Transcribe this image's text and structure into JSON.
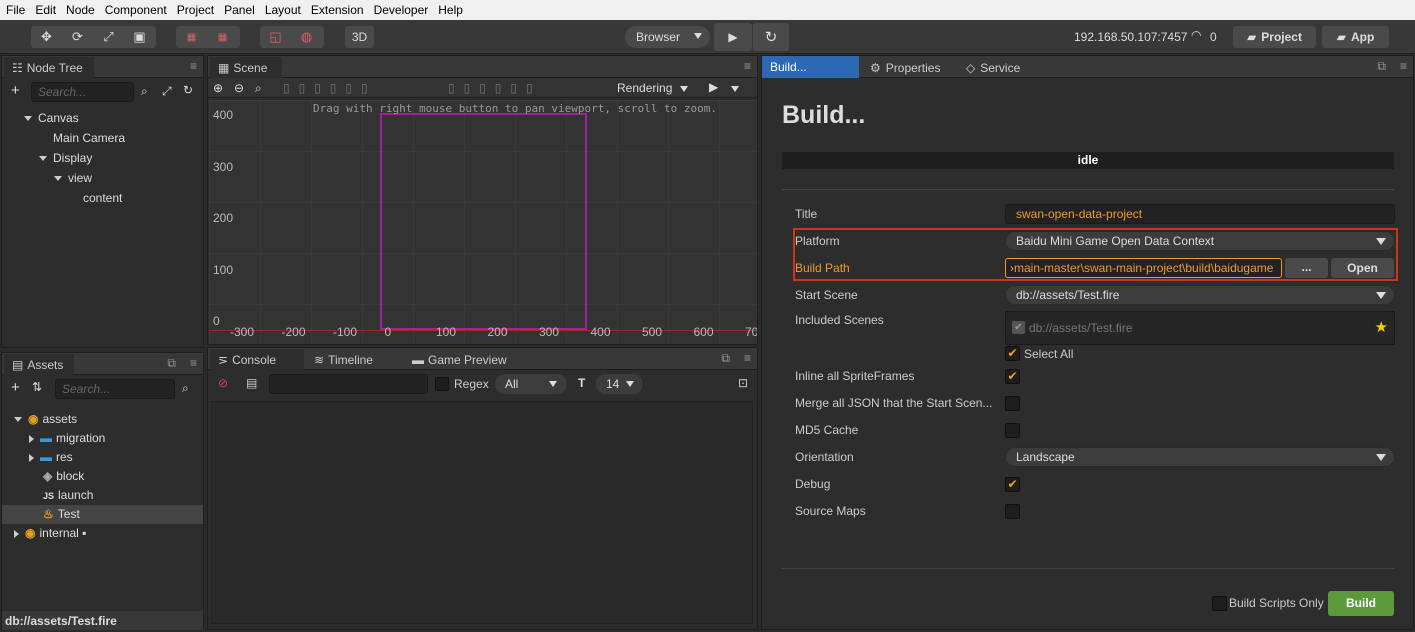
{
  "menu": [
    "File",
    "Edit",
    "Node",
    "Component",
    "Project",
    "Panel",
    "Layout",
    "Extension",
    "Developer",
    "Help"
  ],
  "toolbar": {
    "mode3d": "3D",
    "browser": "Browser",
    "ip": "192.168.50.107:7457",
    "conn": "0",
    "project": "Project",
    "app": "App"
  },
  "nodetree": {
    "tab": "Node Tree",
    "search": "Search...",
    "items": [
      {
        "label": "Canvas",
        "depth": 0,
        "arrow": "down"
      },
      {
        "label": "Main Camera",
        "depth": 1,
        "arrow": "none"
      },
      {
        "label": "Display",
        "depth": 1,
        "arrow": "down"
      },
      {
        "label": "view",
        "depth": 2,
        "arrow": "down"
      },
      {
        "label": "content",
        "depth": 3,
        "arrow": "none"
      }
    ]
  },
  "assets": {
    "tab": "Assets",
    "search": "Search...",
    "items": [
      {
        "label": "assets",
        "icon": "db",
        "depth": 0,
        "arrow": "down"
      },
      {
        "label": "migration",
        "icon": "folder",
        "depth": 1,
        "arrow": "right"
      },
      {
        "label": "res",
        "icon": "folder",
        "depth": 1,
        "arrow": "right"
      },
      {
        "label": "block",
        "icon": "prefab",
        "depth": 1,
        "arrow": "none"
      },
      {
        "label": "launch",
        "icon": "js",
        "depth": 1,
        "arrow": "none"
      },
      {
        "label": "Test",
        "icon": "scene",
        "depth": 1,
        "arrow": "none",
        "selected": true
      },
      {
        "label": "internal",
        "icon": "db",
        "depth": 0,
        "arrow": "right",
        "locked": true
      }
    ],
    "footer": "db://assets/Test.fire"
  },
  "scene": {
    "tab": "Scene",
    "rendering": "Rendering",
    "hint": "Drag with right mouse button to pan viewport, scroll to zoom.",
    "yticks": [
      "400",
      "300",
      "200",
      "100",
      "0"
    ],
    "xticks": [
      "-300",
      "-200",
      "-100",
      "0",
      "100",
      "200",
      "300",
      "400",
      "500",
      "600",
      "70"
    ]
  },
  "console": {
    "tabs": [
      "Console",
      "Timeline",
      "Game Preview"
    ],
    "regex": "Regex",
    "level": "All",
    "fontsize": "14"
  },
  "build": {
    "tabs": [
      "Build...",
      "Properties",
      "Service"
    ],
    "heading": "Build...",
    "status": "idle",
    "title_label": "Title",
    "title_value": "swan-open-data-project",
    "platform_label": "Platform",
    "platform_value": "Baidu Mini Game Open Data Context",
    "buildpath_label": "Build Path",
    "buildpath_value": "›main-master\\swan-main-project\\build\\baidugame",
    "browse": "...",
    "open": "Open",
    "startscene_label": "Start Scene",
    "startscene_value": "db://assets/Test.fire",
    "included_label": "Included Scenes",
    "included_value": "db://assets/Test.fire",
    "selectall": "Select All",
    "inline_label": "Inline all SpriteFrames",
    "merge_label": "Merge all JSON that the Start Scen...",
    "md5_label": "MD5 Cache",
    "orient_label": "Orientation",
    "orient_value": "Landscape",
    "debug_label": "Debug",
    "sourcemaps_label": "Source Maps",
    "scriptsonly": "Build Scripts Only",
    "build_btn": "Build"
  },
  "colors": {
    "accent": "#f09a2a",
    "highlight": "#d0321e",
    "buildtab": "#2d69b2",
    "buildbtn": "#5a9a3a",
    "frame": "#a020a0"
  }
}
